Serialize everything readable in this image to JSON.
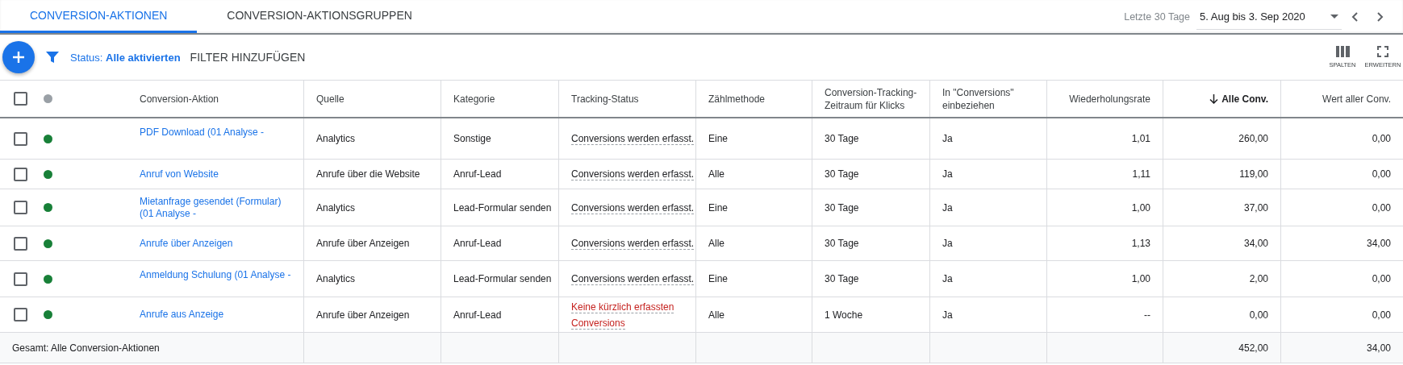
{
  "tabs": [
    {
      "label": "CONVERSION-AKTIONEN",
      "selected": true
    },
    {
      "label": "CONVERSION-AKTIONSGRUPPEN",
      "selected": false
    }
  ],
  "date_range": {
    "label": "Letzte 30 Tage",
    "value": "5. Aug bis 3. Sep 2020"
  },
  "toolbar": {
    "status_label": "Status:",
    "status_value": "Alle aktivierten",
    "add_filter": "FILTER HINZUFÜGEN",
    "actions": [
      {
        "kind": "columns",
        "label": "SPALTEN"
      },
      {
        "kind": "expand",
        "label": "ERWEITERN"
      }
    ]
  },
  "table": {
    "select_all_checked": false,
    "columns": [
      {
        "label": "Conversion-Aktion",
        "kind": "text",
        "sorted": false
      },
      {
        "label": "Quelle",
        "kind": "text",
        "sorted": false
      },
      {
        "label": "Kategorie",
        "kind": "text",
        "sorted": false
      },
      {
        "label": "Tracking-Status",
        "kind": "text",
        "sorted": false
      },
      {
        "label": "Zählmethode",
        "kind": "text",
        "sorted": false
      },
      {
        "label": "Conversion-Tracking-Zeitraum für Klicks",
        "kind": "text",
        "sorted": false
      },
      {
        "label": "In \"Conversions\" einbeziehen",
        "kind": "text",
        "sorted": false
      },
      {
        "label": "Wiederholungsrate",
        "kind": "number",
        "sorted": false
      },
      {
        "label": "Alle Conv.",
        "kind": "number",
        "sorted": true
      },
      {
        "label": "Wert aller Conv.",
        "kind": "number",
        "sorted": false
      }
    ],
    "rows": [
      {
        "checked": false,
        "enabled": true,
        "cells": [
          "PDF Download (01 Analyse -",
          "Analytics",
          "Sonstige",
          {
            "text": "Conversions werden erfasst.",
            "kind": "ok"
          },
          "Eine",
          "30 Tage",
          "Ja",
          "1,01",
          "260,00",
          "0,00"
        ]
      },
      {
        "checked": false,
        "enabled": true,
        "cells": [
          "Anruf von Website",
          "Anrufe über die Website",
          "Anruf-Lead",
          {
            "text": "Conversions werden erfasst.",
            "kind": "ok"
          },
          "Alle",
          "30 Tage",
          "Ja",
          "1,11",
          "119,00",
          "0,00"
        ]
      },
      {
        "checked": false,
        "enabled": true,
        "cells": [
          "Mietanfrage gesendet (Formular) (01 Analyse -",
          "Analytics",
          "Lead-Formular senden",
          {
            "text": "Conversions werden erfasst.",
            "kind": "ok"
          },
          "Eine",
          "30 Tage",
          "Ja",
          "1,00",
          "37,00",
          "0,00"
        ]
      },
      {
        "checked": false,
        "enabled": true,
        "cells": [
          "Anrufe über Anzeigen",
          "Anrufe über Anzeigen",
          "Anruf-Lead",
          {
            "text": "Conversions werden erfasst.",
            "kind": "ok"
          },
          "Alle",
          "30 Tage",
          "Ja",
          "1,13",
          "34,00",
          "34,00"
        ]
      },
      {
        "checked": false,
        "enabled": true,
        "cells": [
          "Anmeldung Schulung (01 Analyse -",
          "Analytics",
          "Lead-Formular senden",
          {
            "text": "Conversions werden erfasst.",
            "kind": "ok"
          },
          "Eine",
          "30 Tage",
          "Ja",
          "1,00",
          "2,00",
          "0,00"
        ]
      },
      {
        "checked": false,
        "enabled": true,
        "cells": [
          "Anrufe aus Anzeige",
          "Anrufe über Anzeigen",
          "Anruf-Lead",
          {
            "text": "Keine kürzlich erfassten Conversions",
            "kind": "warning"
          },
          "Alle",
          "1 Woche",
          "Ja",
          "--",
          "0,00",
          "0,00"
        ]
      }
    ],
    "total": {
      "label": "Gesamt: Alle Conversion-Aktionen",
      "values": [
        "452,00",
        "34,00"
      ]
    }
  }
}
